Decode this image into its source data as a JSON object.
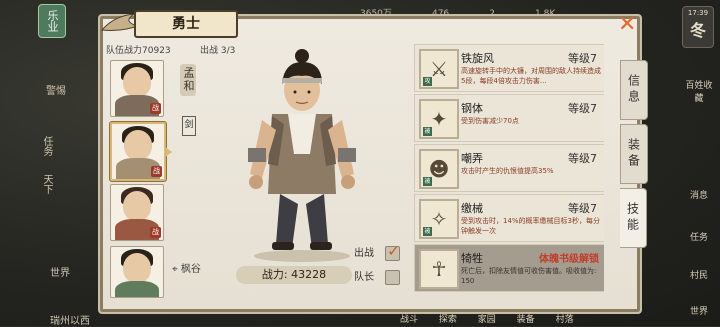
{
  "hud": {
    "left_badge": "乐业",
    "left_items": [
      "警惕",
      "任务",
      "天下",
      "世界",
      "瑞州以西"
    ],
    "top_stats": [
      "3650万",
      "476",
      "2",
      "1.8K"
    ],
    "date_time": "17:39",
    "date_day": "冬",
    "right_items": [
      "百姓收藏",
      "消息",
      "任务",
      "村民",
      "世界"
    ],
    "bottom_items": [
      "战斗",
      "探索",
      "家园",
      "装备",
      "村落"
    ]
  },
  "panel": {
    "title": "勇士",
    "team_power_label": "队伍战力",
    "team_power": "70923",
    "out_label": "出战",
    "out_value": "3/3",
    "close_label": "✕",
    "trait_label": "孟和",
    "trait2_label": "剑",
    "location": "枫谷",
    "char_power_label": "战力:",
    "char_power": "43228",
    "deploy_label": "出战",
    "deploy_checked": true,
    "captain_label": "队长",
    "captain_checked": false
  },
  "portraits": [
    {
      "tag": "战",
      "hair": "#2a2119",
      "body": "#7d6c5b"
    },
    {
      "tag": "战",
      "hair": "#2b221a",
      "body": "#a58f73"
    },
    {
      "tag": "战",
      "hair": "#3a2a1f",
      "body": "#9a5842"
    },
    {
      "tag": "",
      "hair": "#2a2119",
      "body": "#5f7d5c"
    }
  ],
  "skills": [
    {
      "name": "铁旋风",
      "level": "等级7",
      "glyph": "⚔",
      "tag": "攻",
      "desc": "高速旋转手中的大镰，对周围的敌人持续造成5段，每段4倍攻击力伤害..."
    },
    {
      "name": "钢体",
      "level": "等级7",
      "glyph": "✦",
      "tag": "被",
      "desc": "受到伤害减少70点"
    },
    {
      "name": "嘲弄",
      "level": "等级7",
      "glyph": "☻",
      "tag": "被",
      "desc": "攻击时产生的仇恨值提高35%"
    },
    {
      "name": "缴械",
      "level": "等级7",
      "glyph": "✧",
      "tag": "被",
      "desc": "受到攻击时，14%的概率缴械目标3秒，每分钟触发一次"
    },
    {
      "name": "犄牲",
      "level": "体魄书级解锁",
      "glyph": "☥",
      "tag": "",
      "desc": "死亡后，扣除友情值可收伤害值。吸收值为: 150",
      "locked": true
    }
  ],
  "tabs": [
    {
      "label": "信息",
      "active": false
    },
    {
      "label": "装备",
      "active": false
    },
    {
      "label": "技能",
      "active": true
    }
  ],
  "colors": {
    "accent": "#e26a2c",
    "locked_text": "#c13e2c",
    "panel_bg": "#ece7dc"
  }
}
